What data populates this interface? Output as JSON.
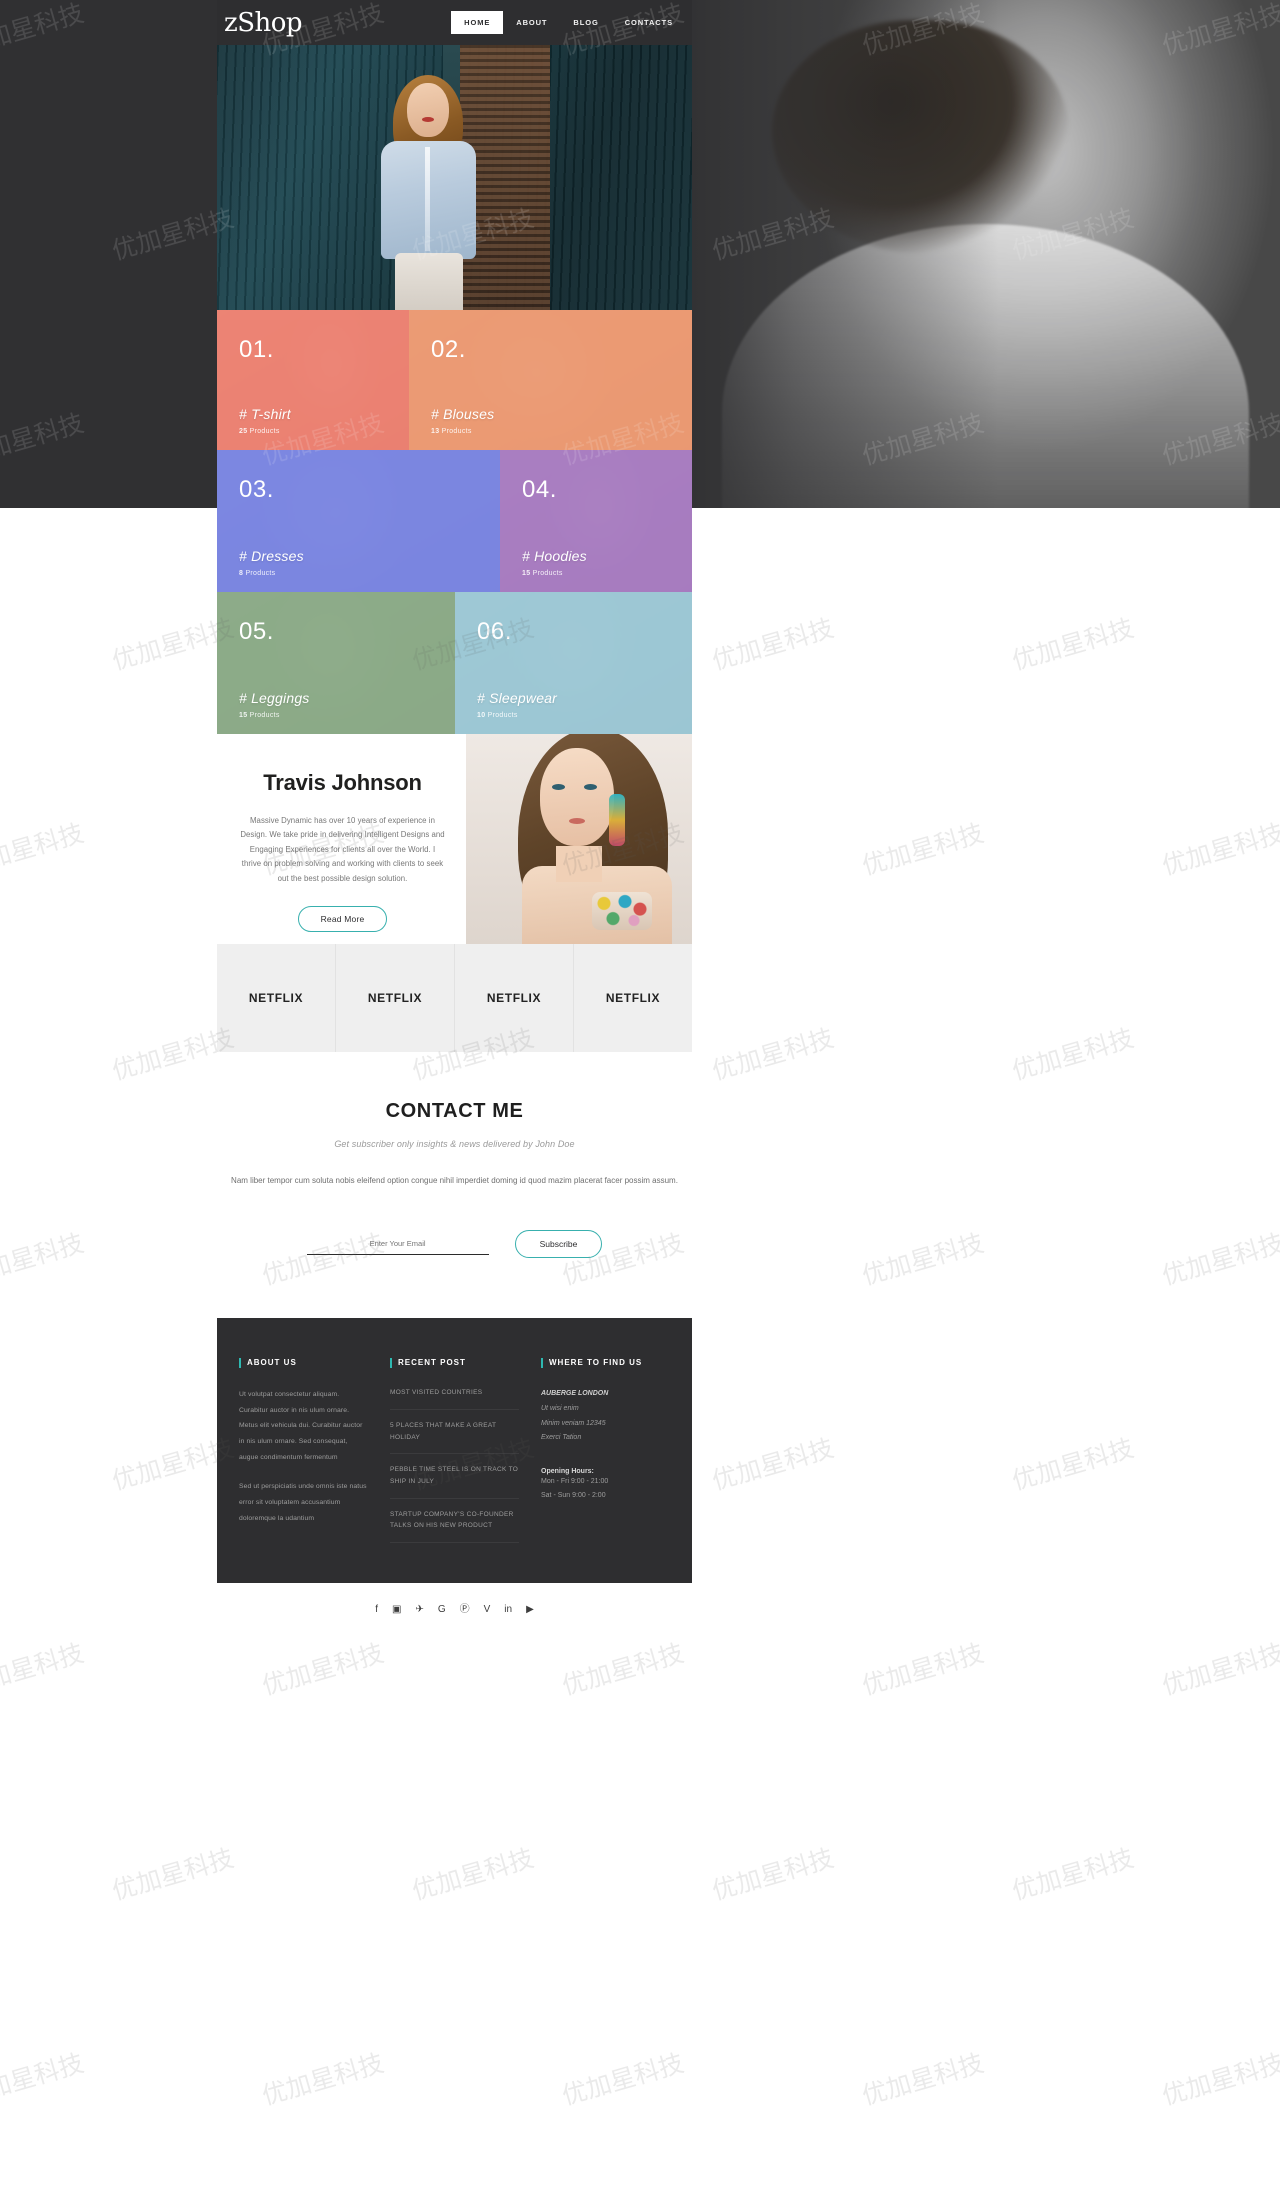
{
  "header": {
    "logo": "zShop",
    "nav": [
      {
        "label": "HOME",
        "active": true
      },
      {
        "label": "ABOUT",
        "active": false
      },
      {
        "label": "BLOG",
        "active": false
      },
      {
        "label": "CONTACTS",
        "active": false
      }
    ]
  },
  "categories": [
    {
      "num": "01.",
      "name": "# T-shirt",
      "count": "25",
      "count_label": "Products",
      "color": "#ec8273"
    },
    {
      "num": "02.",
      "name": "# Blouses",
      "count": "13",
      "count_label": "Products",
      "color": "#eb9a74"
    },
    {
      "num": "03.",
      "name": "# Dresses",
      "count": "8",
      "count_label": "Products",
      "color": "#7b86e0"
    },
    {
      "num": "04.",
      "name": "# Hoodies",
      "count": "15",
      "count_label": "Products",
      "color": "#a87dc0"
    },
    {
      "num": "05.",
      "name": "# Leggings",
      "count": "15",
      "count_label": "Products",
      "color": "#8cab88"
    },
    {
      "num": "06.",
      "name": "# Sleepwear",
      "count": "10",
      "count_label": "Products",
      "color": "#9dc7d4"
    }
  ],
  "about": {
    "title": "Travis Johnson",
    "paragraph": "Massive Dynamic has over 10 years of experience in Design. We take pride in delivering Intelligent Designs and Engaging Experiences for clients all over the World. I thrive on problem solving and working with clients to seek out the best possible design solution.",
    "button": "Read More"
  },
  "brands": [
    "NETFLIX",
    "NETFLIX",
    "NETFLIX",
    "NETFLIX"
  ],
  "contact": {
    "title": "CONTACT ME",
    "subtitle": "Get subscriber only insights & news delivered by John Doe",
    "body": "Nam liber tempor cum soluta nobis eleifend option congue nihil imperdiet doming id quod mazim placerat facer possim assum.",
    "email_placeholder": "Enter Your Email",
    "email_value": "",
    "subscribe_label": "Subscribe"
  },
  "footer": {
    "about": {
      "title": "ABOUT US",
      "p1": "Ut volutpat consectetur aliquam. Curabitur auctor in nis ulum ornare. Metus elit vehicula dui. Curabitur auctor in nis ulum ornare. Sed consequat, augue condimentum fermentum",
      "p2": "Sed ut perspiciatis unde omnis iste natus error sit voluptatem accusantium doloremque la udantium"
    },
    "recent": {
      "title": "RECENT POST",
      "posts": [
        "MOST VISITED COUNTRIES",
        "5 PLACES THAT MAKE A GREAT HOLIDAY",
        "PEBBLE TIME STEEL IS ON TRACK TO SHIP IN JULY",
        "STARTUP COMPANY'S CO-FOUNDER TALKS ON HIS NEW PRODUCT"
      ]
    },
    "find": {
      "title": "WHERE TO FIND US",
      "name": "AUBERGE LONDON",
      "line1": "Ut wisi enim",
      "line2": "Minim veniam 12345",
      "line3": "Exerci Tation",
      "hours_title": "Opening Hours:",
      "hours1": "Mon - Fri 9:00 - 21:00",
      "hours2": "Sat - Sun 9:00 - 2:00"
    }
  },
  "social": [
    {
      "name": "facebook-icon",
      "glyph": "f"
    },
    {
      "name": "instagram-icon",
      "glyph": "▣"
    },
    {
      "name": "twitter-icon",
      "glyph": "✈"
    },
    {
      "name": "google-plus-icon",
      "glyph": "G"
    },
    {
      "name": "pinterest-icon",
      "glyph": "Ⓟ"
    },
    {
      "name": "vimeo-icon",
      "glyph": "V"
    },
    {
      "name": "linkedin-icon",
      "glyph": "in"
    },
    {
      "name": "youtube-icon",
      "glyph": "▶"
    }
  ],
  "watermark": {
    "text": "优加星科技"
  }
}
